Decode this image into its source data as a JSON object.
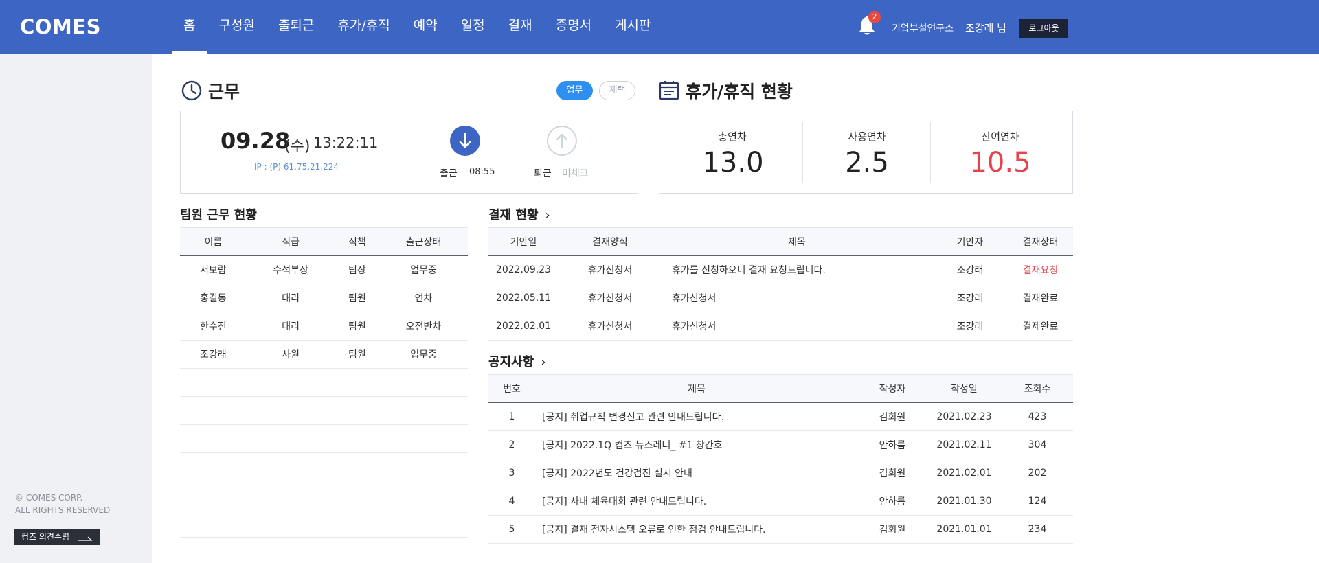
{
  "app": {
    "logo": "COMES"
  },
  "nav": {
    "items": [
      "홈",
      "구성원",
      "출퇴근",
      "휴가/휴직",
      "예약",
      "일정",
      "결재",
      "증명서",
      "게시판"
    ],
    "active_index": 0
  },
  "header": {
    "notification_count": "2",
    "org": "기업부설연구소",
    "user": "조강래 님",
    "logout": "로그아웃"
  },
  "sidebar": {
    "copyright_line1": "© COMES CORP.",
    "copyright_line2": "ALL RIGHTS RESERVED",
    "feedback": "컴즈 의견수렴"
  },
  "work": {
    "title": "근무",
    "mode_active": "업무",
    "mode_inactive": "재택",
    "date": "09.28",
    "day": "(수)",
    "time": "13:22:11",
    "ip": "IP : (P) 61.75.21.224",
    "checkin_label": "출근",
    "checkin_time": "08:55",
    "checkout_label": "퇴근",
    "checkout_status": "미체크"
  },
  "leave": {
    "title": "휴가/휴직 현황",
    "total_label": "총연차",
    "total_value": "13.0",
    "used_label": "사용연차",
    "used_value": "2.5",
    "remain_label": "잔여연차",
    "remain_value": "10.5"
  },
  "team": {
    "title": "팀원 근무 현황",
    "columns": [
      "이름",
      "직급",
      "직책",
      "출근상태"
    ],
    "rows": [
      [
        "서보람",
        "수석부장",
        "팀장",
        "업무중"
      ],
      [
        "홍길동",
        "대리",
        "팀원",
        "연차"
      ],
      [
        "한수진",
        "대리",
        "팀원",
        "오전반차"
      ],
      [
        "조강래",
        "사원",
        "팀원",
        "업무중"
      ]
    ],
    "empty_rows": 6
  },
  "approval": {
    "title": "결재 현황",
    "columns": [
      "기안일",
      "결재양식",
      "제목",
      "기안자",
      "결재상태"
    ],
    "rows": [
      [
        "2022.09.23",
        "휴가신청서",
        "휴가를 신청하오니 결재 요청드립니다.",
        "조강래",
        "결재요청"
      ],
      [
        "2022.05.11",
        "휴가신청서",
        "휴가신청서",
        "조강래",
        "결재완료"
      ],
      [
        "2022.02.01",
        "휴가신청서",
        "휴가신청서",
        "조강래",
        "결제완료"
      ]
    ],
    "status_colors": {
      "결재요청": "#e8434b"
    }
  },
  "notice": {
    "title": "공지사항",
    "columns": [
      "번호",
      "제목",
      "작성자",
      "작성일",
      "조회수"
    ],
    "rows": [
      [
        "1",
        "[공지] 취업규칙 변경신고 관련 안내드립니다.",
        "김회원",
        "2021.02.23",
        "423"
      ],
      [
        "2",
        "[공지] 2022.1Q 컴즈 뉴스레터_ #1 창간호",
        "안하름",
        "2021.02.11",
        "304"
      ],
      [
        "3",
        "[공지] 2022년도 건강검진 실시 안내",
        "김회원",
        "2021.02.01",
        "202"
      ],
      [
        "4",
        "[공지] 사내 체육대회 관련 안내드립니다.",
        "안하름",
        "2021.01.30",
        "124"
      ],
      [
        "5",
        "[공지] 결재 전자시스템 오류로 인한 점검 안내드립니다.",
        "김회원",
        "2021.01.01",
        "234"
      ]
    ]
  },
  "colors": {
    "primary": "#3d65c3",
    "accent_blue": "#2f8ff0",
    "red": "#e8434b"
  }
}
